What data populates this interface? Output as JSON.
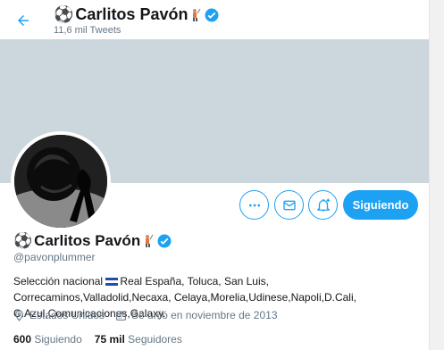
{
  "header": {
    "name": "Carlitos Pavón",
    "tweet_count": "11,6 mil Tweets"
  },
  "actions": {
    "more_icon": "more-icon",
    "message_icon": "envelope-icon",
    "notify_icon": "bell-plus-icon",
    "follow_label": "Siguiendo"
  },
  "profile": {
    "name": "Carlitos Pavón",
    "handle": "@pavonplummer",
    "bio_prefix": "Selección nacional",
    "bio_rest": "Real España, Toluca, San Luis, Correcaminos,Valladolid,Necaxa, Celaya,Morelia,Udinese,Napoli,D.Cali, C.Azul,Comunicaciones,Galaxy.",
    "location": "Estados Unidos",
    "joined": "Se unió en noviembre de 2013"
  },
  "stats": {
    "following_count": "600",
    "following_label": "Siguiendo",
    "followers_count": "75 mil",
    "followers_label": "Seguidores"
  },
  "colors": {
    "accent": "#1da1f2",
    "banner": "#ccd6dd",
    "secondary_text": "#657786"
  }
}
